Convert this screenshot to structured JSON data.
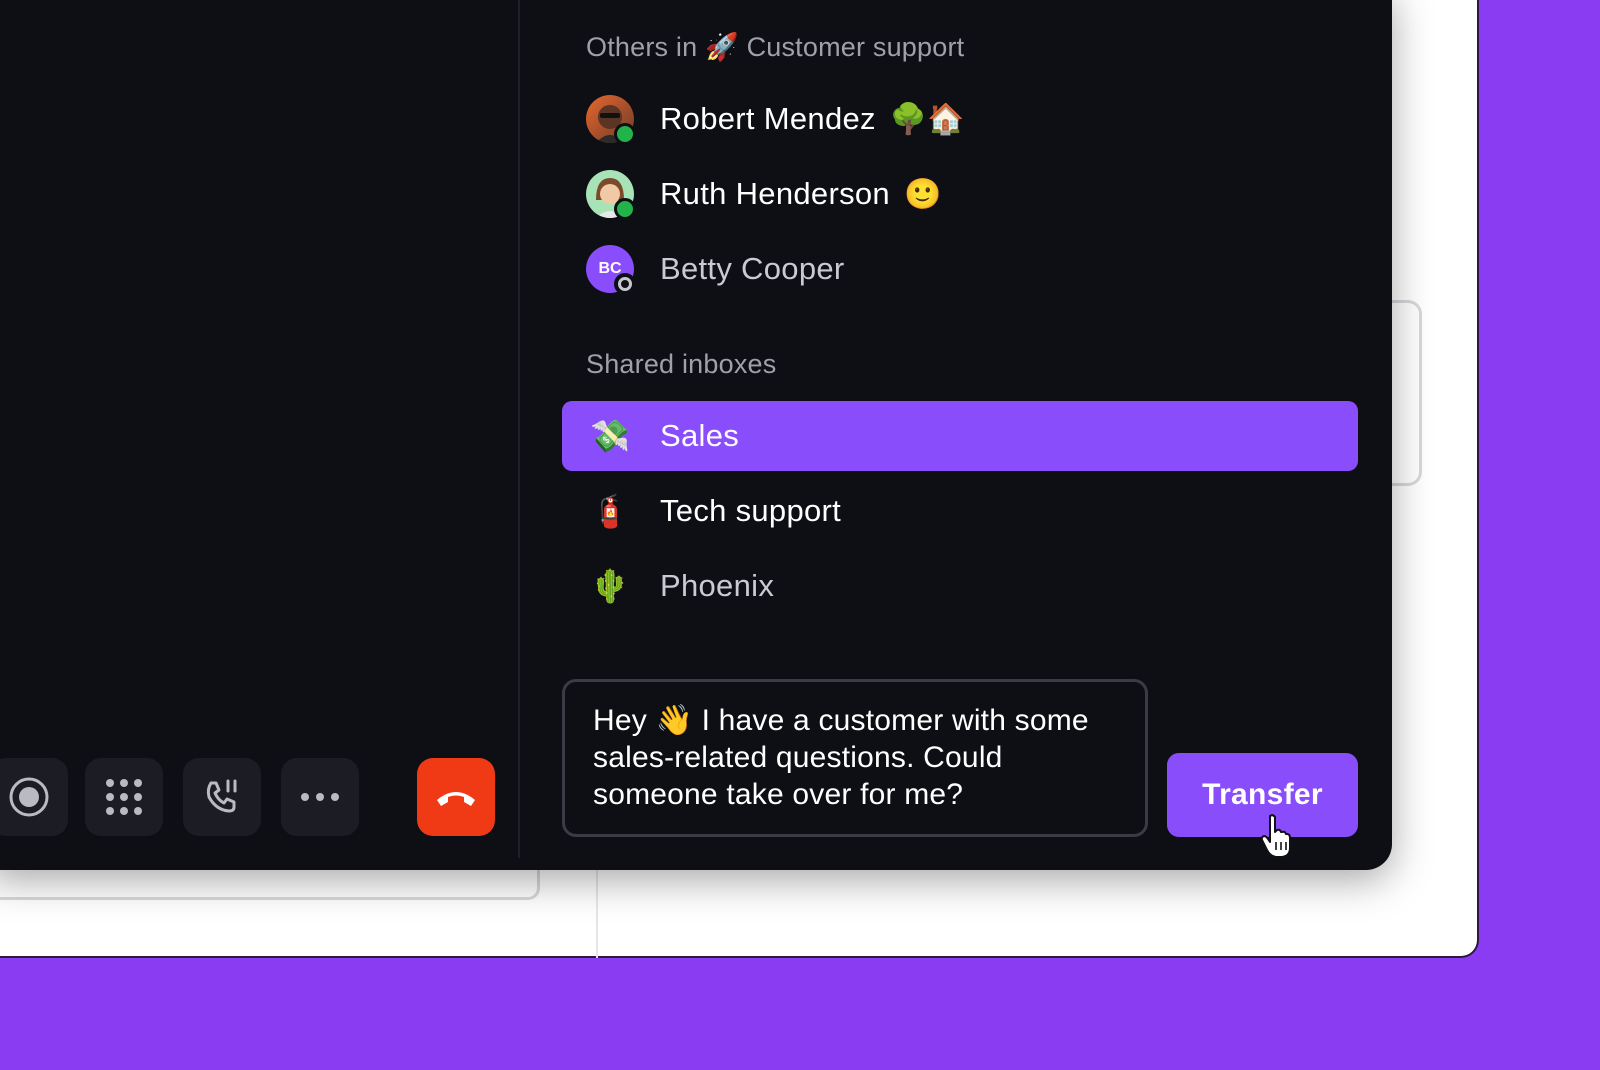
{
  "others_section": {
    "title": "Others in 🚀 Customer support",
    "people": [
      {
        "name": "Robert Mendez",
        "emoji": "🌳🏠",
        "status": "online",
        "avatar_icon": "memoji-avatar"
      },
      {
        "name": "Ruth Henderson",
        "emoji": "🙂",
        "status": "online",
        "avatar_icon": "memoji-avatar"
      },
      {
        "name": "Betty Cooper",
        "emoji": "",
        "status": "away",
        "initials": "BC"
      }
    ]
  },
  "inboxes_section": {
    "title": "Shared inboxes",
    "inboxes": [
      {
        "name": "Sales",
        "icon": "💸",
        "selected": true
      },
      {
        "name": "Tech support",
        "icon": "🧯",
        "selected": false
      },
      {
        "name": "Phoenix",
        "icon": "🌵",
        "selected": false
      }
    ]
  },
  "message": {
    "text": "Hey 👋 I have a customer with some sales-related questions. Could someone take over for me?"
  },
  "transfer_button": {
    "label": "Transfer"
  },
  "call_controls": [
    "record-icon",
    "keypad-icon",
    "phone-transfer-icon",
    "more-icon",
    "hangup-icon"
  ],
  "colors": {
    "accent": "#8a4dfb",
    "background": "#8a3cf2",
    "panel": "#0e0f14",
    "hangup": "#f03a16",
    "online": "#22b34a"
  }
}
